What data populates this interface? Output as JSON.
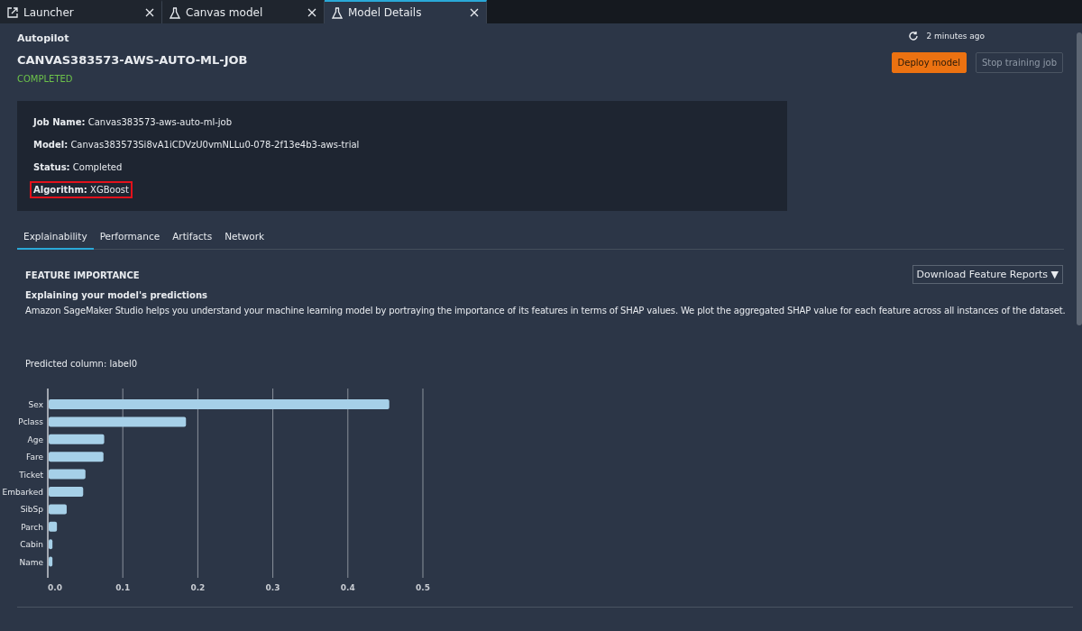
{
  "tabs": [
    {
      "label": "Launcher",
      "kind": "launcher",
      "selected": false
    },
    {
      "label": "Canvas model",
      "kind": "model",
      "selected": false
    },
    {
      "label": "Model Details",
      "kind": "model",
      "selected": true
    }
  ],
  "header": {
    "breadcrumb": "Autopilot",
    "title": "CANVAS383573-AWS-AUTO-ML-JOB",
    "status": "COMPLETED",
    "updated": "2 minutes ago"
  },
  "actions": [
    {
      "label": "Deploy model",
      "kind": "primary"
    },
    {
      "label": "Stop training job",
      "kind": "disabled"
    }
  ],
  "details": [
    {
      "label": "Job Name:",
      "value": "Canvas383573-aws-auto-ml-job",
      "highlighted": false
    },
    {
      "label": "Model:",
      "value": "Canvas383573Si8vA1iCDVzU0vmNLLu0-078-2f13e4b3-aws-trial",
      "highlighted": false
    },
    {
      "label": "Status:",
      "value": "Completed",
      "highlighted": false
    },
    {
      "label": "Algorithm:",
      "value": "XGBoost",
      "highlighted": true
    }
  ],
  "section_tabs": [
    {
      "label": "Explainability",
      "selected": true
    },
    {
      "label": "Performance",
      "selected": false
    },
    {
      "label": "Artifacts",
      "selected": false
    },
    {
      "label": "Network",
      "selected": false
    }
  ],
  "feature_importance": {
    "heading": "FEATURE IMPORTANCE",
    "download": "Download Feature Reports ▼",
    "subheading": "Explaining your model's predictions",
    "description": "Amazon SageMaker Studio helps you understand your machine learning model by portraying the importance of its features in terms of SHAP values. We plot the aggregated SHAP value for each feature across all instances of the dataset.",
    "predicted_column": "Predicted column: label0",
    "chart_data": {
      "type": "bar",
      "orientation": "horizontal",
      "categories": [
        "Sex",
        "Pclass",
        "Age",
        "Fare",
        "Ticket",
        "Embarked",
        "SibSp",
        "Parch",
        "Cabin",
        "Name"
      ],
      "grid": true,
      "series": [
        {
          "color": "#a6d0e8",
          "values": [
            0.454,
            0.183,
            0.074,
            0.073,
            0.049,
            0.046,
            0.024,
            0.011,
            0.005,
            0.005
          ]
        }
      ],
      "xlim": [
        0,
        0.5
      ],
      "xticks": [
        {
          "value": 0,
          "label": "0.0"
        },
        {
          "value": 0.1,
          "label": "0.1"
        },
        {
          "value": 0.2,
          "label": "0.2"
        },
        {
          "value": 0.3,
          "label": "0.3"
        },
        {
          "value": 0.4,
          "label": "0.4"
        },
        {
          "value": 0.5,
          "label": "0.5"
        }
      ]
    }
  }
}
